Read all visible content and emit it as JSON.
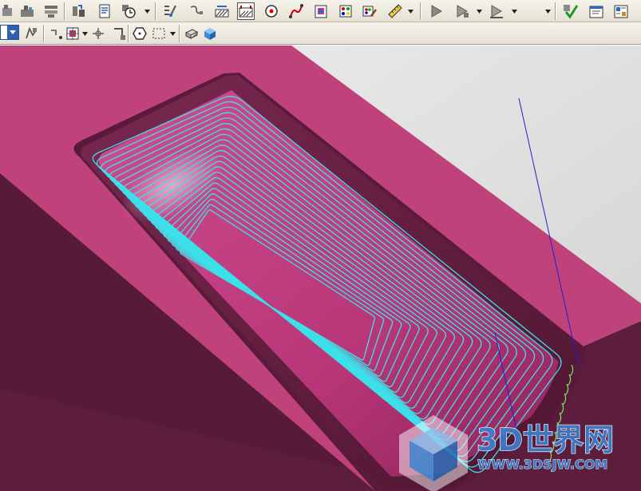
{
  "app": {
    "name": "NX CAM toolpath viewport"
  },
  "toolbar_top": {
    "buttons": [
      "insert-operation-icon",
      "insert-program-icon",
      "machine-tool-view-icon",
      "generate-toolpath-icon",
      "shop-docs-icon",
      "clock-icon",
      "program-order-icon",
      "path-edit-icon",
      "cut-area-icon",
      "pocket-icon",
      "circle-point-icon",
      "curve-icon",
      "clipboard-icon",
      "palette-icon",
      "palette-brush-icon",
      "measure-icon",
      "replay-icon",
      "verify-icon",
      "simulate-icon",
      "check-icon",
      "list-window-icon",
      "properties-icon"
    ]
  },
  "toolbar_second": {
    "buttons": [
      "selection-filter-combo",
      "snap-icon",
      "point-constructor-icon",
      "face-select-icon",
      "transform-icon",
      "move-icon",
      "hexagon-icon",
      "rectangle-select-icon",
      "shaded-edge-icon",
      "shaded-solid-icon"
    ]
  },
  "viewport": {
    "part_color": "#c0427a",
    "side_color": "#5c1e3c",
    "toolpath_color": "#3de0e8",
    "tool_axis_color": "#2020d0",
    "background_color": "#dcdcdc"
  },
  "watermark": {
    "title": "3D世界网",
    "url": "WWW.3DSJW.COM"
  }
}
